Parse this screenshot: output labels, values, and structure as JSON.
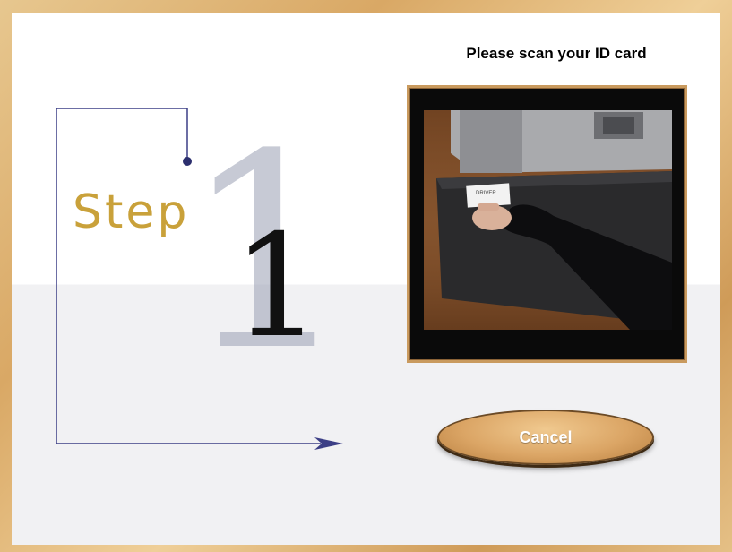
{
  "prompt": {
    "heading": "Please scan your ID card"
  },
  "step_graphic": {
    "word": "Step",
    "number": "1"
  },
  "video": {
    "card_text": "DRIVER"
  },
  "actions": {
    "cancel_label": "Cancel"
  },
  "colors": {
    "frame_wood": "#d9a865",
    "step_gold": "#c9a13a",
    "guide_line": "#3c3f86",
    "button_fill": "#dba565"
  }
}
